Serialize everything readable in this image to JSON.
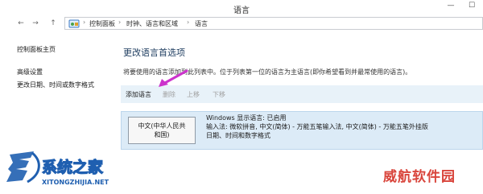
{
  "window": {
    "title": "语言",
    "minimize_glyph": "—",
    "maximize_glyph": "☐"
  },
  "nav": {
    "back_glyph": "←",
    "forward_glyph": "→",
    "up_glyph": "↑",
    "address_icon": "control-panel-icon",
    "separator": "›",
    "breadcrumbs": [
      "控制面板",
      "时钟、语言和区域",
      "语言"
    ]
  },
  "sidebar": {
    "items": [
      {
        "label": "控制面板主页"
      },
      {
        "label": "高级设置"
      },
      {
        "label": "更改日期、时间或数字格式"
      }
    ]
  },
  "main": {
    "heading": "更改语言首选项",
    "description": "将要使用的语言添加到此列表中。位于列表第一位的语言为主语言(即你希望看到并最常使用的语言)。",
    "toolbar": {
      "add": "添加语言",
      "remove": "删除",
      "up": "上移",
      "down": "下移"
    },
    "language": {
      "name_line1": "中文(中华人民共",
      "name_line2": "和国)",
      "info_line1": "Windows 显示语言: 已启用",
      "info_line2": "输入法: 微软拼音, 中文(简体) - 万能五笔输入法, 中文(简体) - 万能五笔外挂版",
      "info_line3": "日期、时间和数字格式"
    }
  },
  "watermark": {
    "left_title": "系统之家",
    "left_url": "XITONGZHIJIA.NET",
    "right_text": "威航软件园"
  },
  "colors": {
    "toolbar_bg": "#e8f2f9",
    "selected_row_bg": "#dcebf7",
    "arrow": "#cc33cc",
    "watermark_blue": "#1f5fb0",
    "watermark_red": "#d9453c"
  }
}
